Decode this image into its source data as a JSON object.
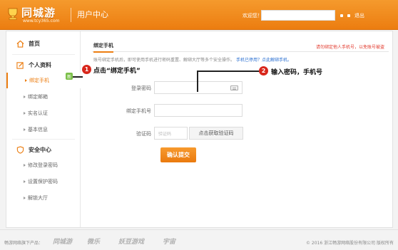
{
  "header": {
    "brand": "同城游",
    "url": "www.tcy365.com",
    "title": "用户中心",
    "welcome": "欢迎您！",
    "links": [
      "退出"
    ]
  },
  "sidebar": {
    "home": "首页",
    "profile": "个人资料",
    "profile_items": [
      "绑定手机",
      "绑定邮箱",
      "实名认证",
      "基本信息"
    ],
    "security": "安全中心",
    "security_items": [
      "修改登录密码",
      "设置保护密码",
      "解锁大厅"
    ],
    "badge": "新"
  },
  "main": {
    "tab": "绑定手机",
    "tab_note": "请勿绑定他人手机号，以免账号被盗",
    "intro": "账号绑定手机后，即可使用手机进行密码重置、解绑大厅等多个安全操作。",
    "intro_link": "手机已停用？点此解绑手机。",
    "form": {
      "password_label": "登录密码",
      "phone_label": "绑定手机号",
      "code_label": "验证码",
      "code_placeholder": "验证码",
      "code_button": "点击获取验证码",
      "submit": "确认提交"
    }
  },
  "callouts": [
    {
      "num": "1",
      "text": "点击“绑定手机”"
    },
    {
      "num": "2",
      "text": "输入密码，手机号"
    }
  ],
  "footer": {
    "label": "畅游网络旗下产品：",
    "logos": [
      "同城游",
      "微乐",
      "妖豆游戏",
      "宇宙"
    ],
    "copyright": "© 2016 浙江畅游网络股份有限公司 版权所有"
  },
  "colors": {
    "accent": "#ec7d10",
    "callout": "#d8261b",
    "link": "#2a6fd1",
    "warn": "#e23b2e"
  }
}
